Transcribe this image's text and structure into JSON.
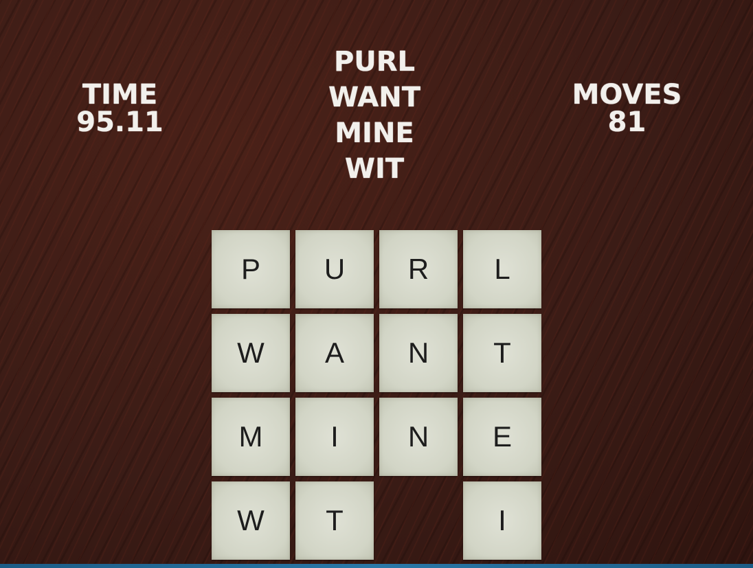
{
  "hud": {
    "time_label": "TIME",
    "time_value": "95.11",
    "moves_label": "MOVES",
    "moves_value": "81"
  },
  "target_words": [
    "PURL",
    "WANT",
    "MINE",
    "WIT"
  ],
  "board": {
    "rows": 4,
    "cols": 4,
    "tiles": [
      {
        "row": 0,
        "col": 0,
        "letter": "P"
      },
      {
        "row": 0,
        "col": 1,
        "letter": "U"
      },
      {
        "row": 0,
        "col": 2,
        "letter": "R"
      },
      {
        "row": 0,
        "col": 3,
        "letter": "L"
      },
      {
        "row": 1,
        "col": 0,
        "letter": "W"
      },
      {
        "row": 1,
        "col": 1,
        "letter": "A"
      },
      {
        "row": 1,
        "col": 2,
        "letter": "N"
      },
      {
        "row": 1,
        "col": 3,
        "letter": "T"
      },
      {
        "row": 2,
        "col": 0,
        "letter": "M"
      },
      {
        "row": 2,
        "col": 1,
        "letter": "I"
      },
      {
        "row": 2,
        "col": 2,
        "letter": "N"
      },
      {
        "row": 2,
        "col": 3,
        "letter": "E"
      },
      {
        "row": 3,
        "col": 0,
        "letter": "W"
      },
      {
        "row": 3,
        "col": 1,
        "letter": "T"
      },
      {
        "row": 3,
        "col": 3,
        "letter": "I"
      }
    ]
  },
  "colors": {
    "background": "#3b1c16",
    "tile": "#d3d6c7",
    "tile_text": "#1d1d1d",
    "hud_text": "#f2f0ec",
    "bottom_bar": "#2a78a8"
  }
}
